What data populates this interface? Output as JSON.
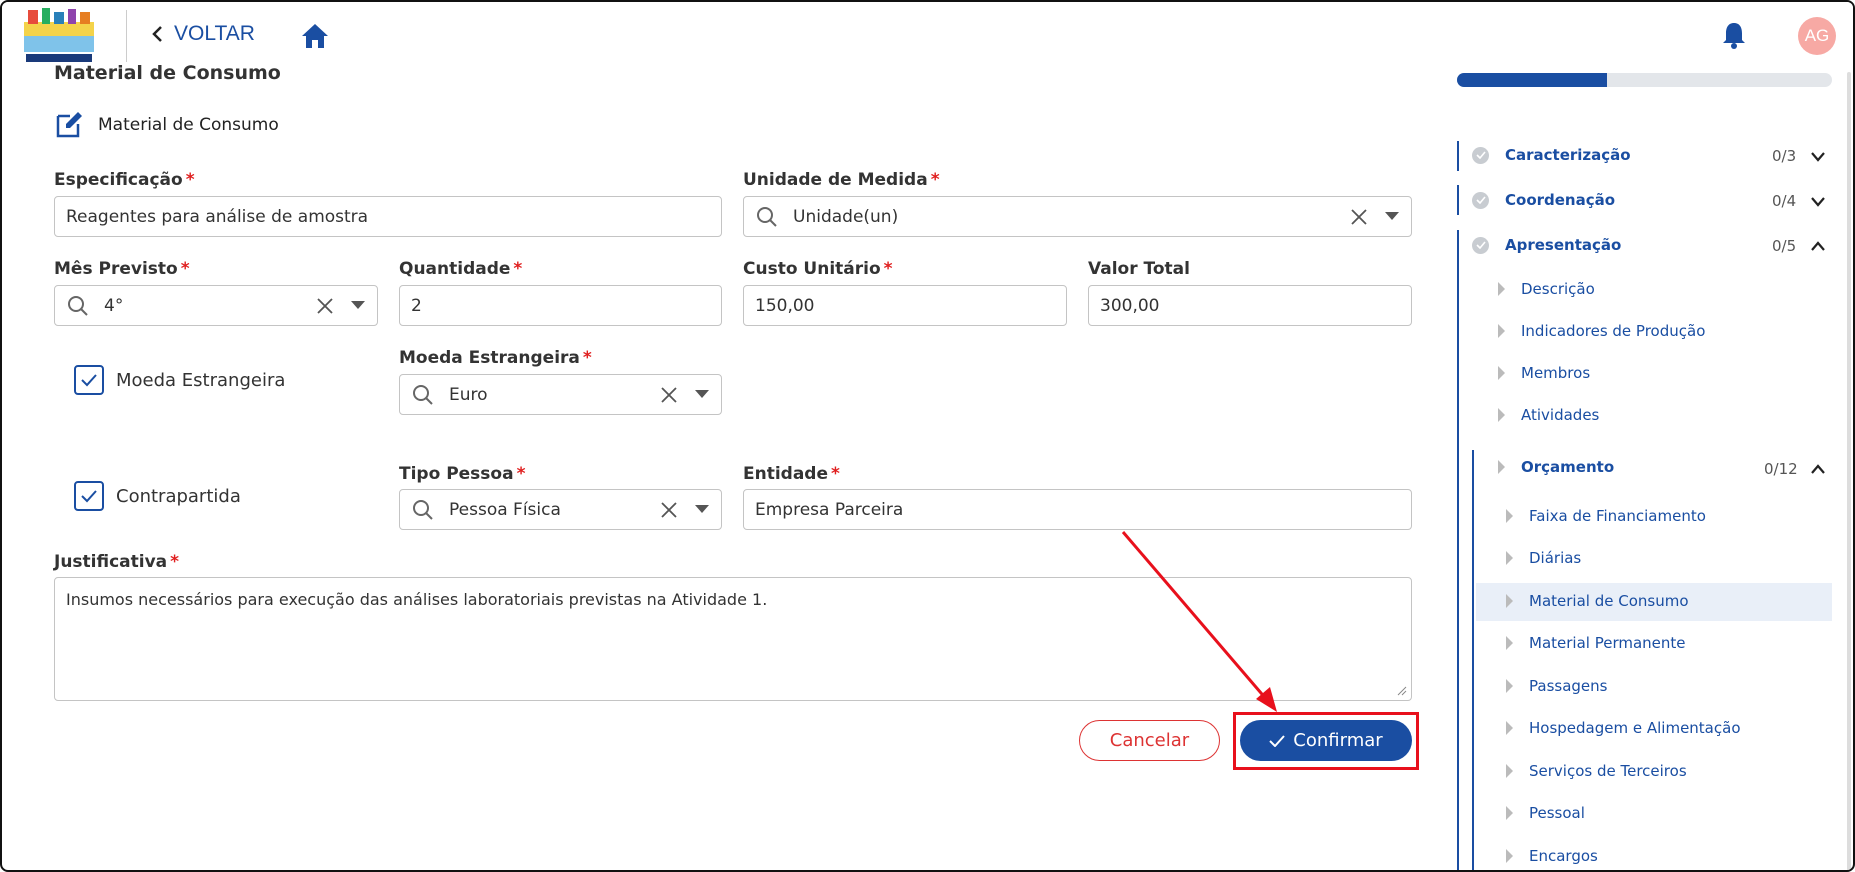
{
  "header": {
    "back_label": "VOLTAR",
    "avatar_initials": "AG"
  },
  "form": {
    "section_title": "Material de Consumo",
    "subtitle": "Material de Consumo",
    "especificacao": {
      "label": "Especificação",
      "value": "Reagentes para análise de amostra"
    },
    "unidade": {
      "label": "Unidade de Medida",
      "value": "Unidade(un)"
    },
    "mes": {
      "label": "Mês Previsto",
      "value": "4°"
    },
    "quantidade": {
      "label": "Quantidade",
      "value": "2"
    },
    "custo": {
      "label": "Custo Unitário",
      "value": "150,00"
    },
    "valor_total": {
      "label": "Valor Total",
      "value": "300,00"
    },
    "moeda_check": {
      "label": "Moeda Estrangeira",
      "checked": true
    },
    "moeda": {
      "label": "Moeda Estrangeira",
      "value": "Euro"
    },
    "contrapartida_check": {
      "label": "Contrapartida",
      "checked": true
    },
    "tipo_pessoa": {
      "label": "Tipo Pessoa",
      "value": "Pessoa Física"
    },
    "entidade": {
      "label": "Entidade",
      "value": "Empresa Parceira"
    },
    "justificativa": {
      "label": "Justificativa",
      "value": "Insumos necessários para execução das análises laboratoriais previstas na Atividade 1."
    },
    "required_mark": "*",
    "cancel_label": "Cancelar",
    "confirm_label": "Confirmar"
  },
  "sidebar": {
    "progress_fraction": 0.4,
    "top": [
      {
        "label": "Caracterização",
        "count": "0/3"
      },
      {
        "label": "Coordenação",
        "count": "0/4"
      },
      {
        "label": "Apresentação",
        "count": "0/5"
      }
    ],
    "apresentacao_items": [
      "Descrição",
      "Indicadores de Produção",
      "Membros",
      "Atividades"
    ],
    "orcamento": {
      "label": "Orçamento",
      "count": "0/12"
    },
    "orcamento_items": [
      "Faixa de Financiamento",
      "Diárias",
      "Material de Consumo",
      "Material Permanente",
      "Passagens",
      "Hospedagem e Alimentação",
      "Serviços de Terceiros",
      "Pessoal",
      "Encargos"
    ],
    "active_item": "Material de Consumo"
  },
  "colors": {
    "primary": "#1a4ea2",
    "danger": "#d33333",
    "highlight": "#e8101c"
  }
}
